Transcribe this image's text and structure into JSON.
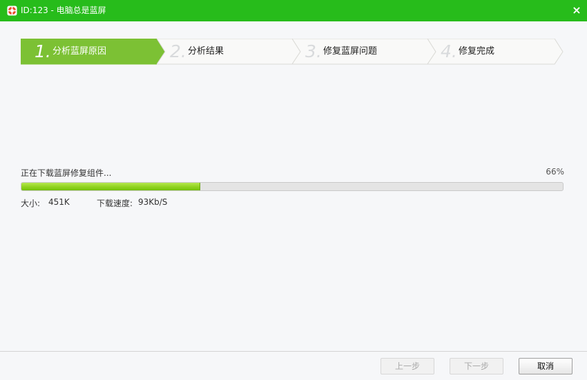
{
  "window": {
    "title": "ID:123 - 电脑总是蓝屏",
    "close_glyph": "×",
    "icon": "lifebuoy-icon"
  },
  "wizard": {
    "steps": [
      {
        "number": "1.",
        "label": "分析蓝屏原因",
        "active": true
      },
      {
        "number": "2.",
        "label": "分析结果",
        "active": false
      },
      {
        "number": "3.",
        "label": "修复蓝屏问题",
        "active": false
      },
      {
        "number": "4.",
        "label": "修复完成",
        "active": false
      }
    ]
  },
  "download": {
    "status_text": "正在下载蓝屏修复组件...",
    "percent_text": "66%",
    "progress_fraction": 0.33,
    "size_label": "大小:",
    "size_value": "451K",
    "speed_label": "下载速度:",
    "speed_value": "93Kb/S"
  },
  "footer": {
    "prev_label": "上一步",
    "next_label": "下一步",
    "cancel_label": "取消"
  },
  "colors": {
    "titlebar": "#27bc1b",
    "active_step": "#7cc134",
    "inactive_step": "#f9f9f8",
    "progress_fill": "#8fd21f"
  }
}
